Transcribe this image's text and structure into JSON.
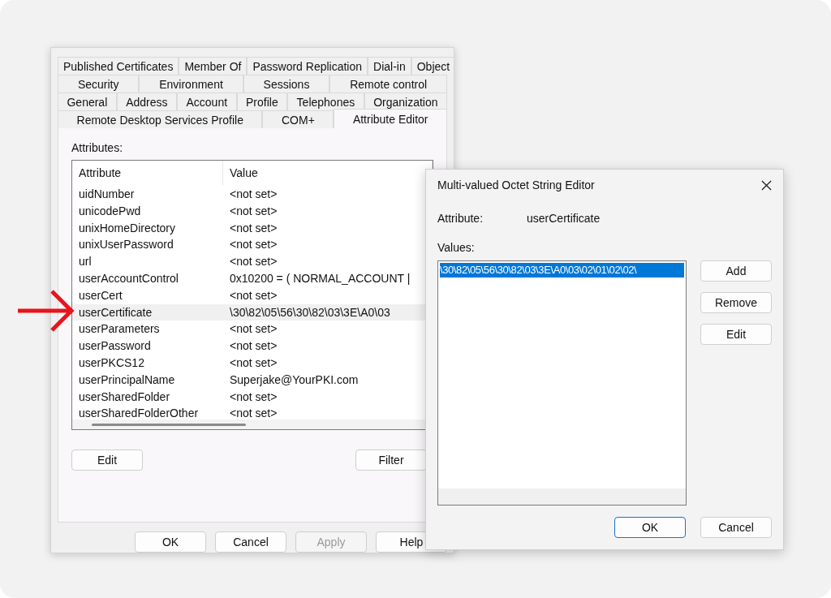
{
  "properties": {
    "tab_rows": [
      [
        {
          "label": "Published Certificates",
          "selected": false
        },
        {
          "label": "Member Of",
          "selected": false
        },
        {
          "label": "Password Replication",
          "selected": false
        },
        {
          "label": "Dial-in",
          "selected": false
        },
        {
          "label": "Object",
          "selected": false
        }
      ],
      [
        {
          "label": "Security",
          "selected": false
        },
        {
          "label": "Environment",
          "selected": false
        },
        {
          "label": "Sessions",
          "selected": false
        },
        {
          "label": "Remote control",
          "selected": false
        }
      ],
      [
        {
          "label": "General",
          "selected": false
        },
        {
          "label": "Address",
          "selected": false
        },
        {
          "label": "Account",
          "selected": false
        },
        {
          "label": "Profile",
          "selected": false
        },
        {
          "label": "Telephones",
          "selected": false
        },
        {
          "label": "Organization",
          "selected": false
        }
      ],
      [
        {
          "label": "Remote Desktop Services Profile",
          "selected": false
        },
        {
          "label": "COM+",
          "selected": false
        },
        {
          "label": "Attribute Editor",
          "selected": true
        }
      ]
    ],
    "attributes_label": "Attributes:",
    "columns": [
      "Attribute",
      "Value"
    ],
    "rows": [
      {
        "attribute": "uidNumber",
        "value": "<not set>",
        "selected": false
      },
      {
        "attribute": "unicodePwd",
        "value": "<not set>",
        "selected": false
      },
      {
        "attribute": "unixHomeDirectory",
        "value": "<not set>",
        "selected": false
      },
      {
        "attribute": "unixUserPassword",
        "value": "<not set>",
        "selected": false
      },
      {
        "attribute": "url",
        "value": "<not set>",
        "selected": false
      },
      {
        "attribute": "userAccountControl",
        "value": "0x10200 = ( NORMAL_ACCOUNT |",
        "selected": false
      },
      {
        "attribute": "userCert",
        "value": "<not set>",
        "selected": false
      },
      {
        "attribute": "userCertificate",
        "value": "\\30\\82\\05\\56\\30\\82\\03\\3E\\A0\\03",
        "selected": true
      },
      {
        "attribute": "userParameters",
        "value": "<not set>",
        "selected": false
      },
      {
        "attribute": "userPassword",
        "value": "<not set>",
        "selected": false
      },
      {
        "attribute": "userPKCS12",
        "value": "<not set>",
        "selected": false
      },
      {
        "attribute": "userPrincipalName",
        "value": "Superjake@YourPKI.com",
        "selected": false
      },
      {
        "attribute": "userSharedFolder",
        "value": "<not set>",
        "selected": false
      },
      {
        "attribute": "userSharedFolderOther",
        "value": "<not set>",
        "selected": false
      }
    ],
    "list_buttons": [
      "Edit",
      "Filter"
    ],
    "buttons": [
      {
        "label": "OK",
        "disabled": false
      },
      {
        "label": "Cancel",
        "disabled": false
      },
      {
        "label": "Apply",
        "disabled": true
      },
      {
        "label": "Help",
        "disabled": false
      }
    ]
  },
  "dialog": {
    "title": "Multi-valued Octet String Editor",
    "attribute_label": "Attribute:",
    "attribute_value": "userCertificate",
    "values_label": "Values:",
    "values": [
      {
        "text": "\\30\\82\\05\\56\\30\\82\\03\\3E\\A0\\03\\02\\01\\02\\02\\",
        "selected": true
      }
    ],
    "side_buttons": [
      "Add",
      "Remove",
      "Edit"
    ],
    "buttons": [
      {
        "label": "OK",
        "default": true
      },
      {
        "label": "Cancel",
        "default": false
      }
    ]
  }
}
